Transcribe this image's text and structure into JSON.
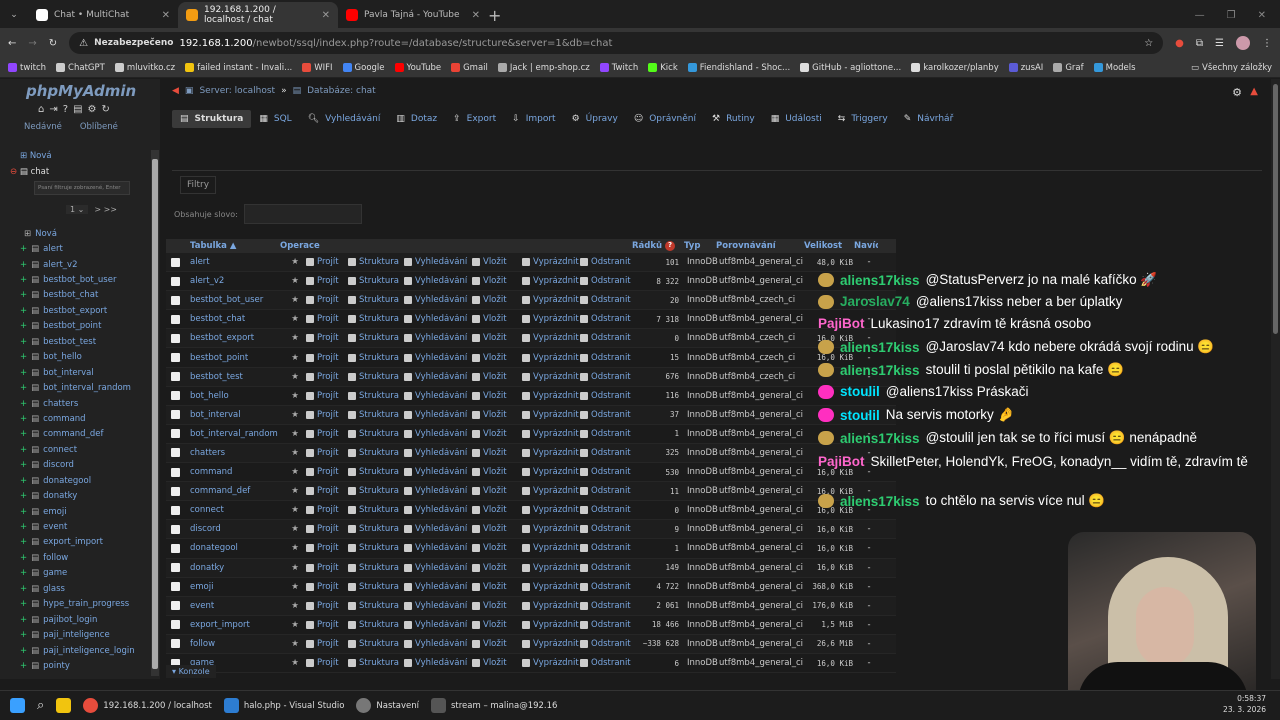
{
  "browser": {
    "tabs": [
      {
        "label": "Chat • MultiChat",
        "color": "#ffffff"
      },
      {
        "label": "192.168.1.200 / localhost / chat",
        "color": "#f39c12"
      },
      {
        "label": "Pavla Tajná - YouTube",
        "color": "#ff0000"
      }
    ],
    "security_badge": "Nezabezpečeno",
    "url_host": "192.168.1.200",
    "url_path": "/newbot/ssql/index.php?route=/database/structure&server=1&db=chat",
    "bookmarks": [
      {
        "label": "twitch",
        "color": "#9146ff"
      },
      {
        "label": "ChatGPT",
        "color": "#cccccc"
      },
      {
        "label": "mluvitko.cz",
        "color": "#cccccc"
      },
      {
        "label": "failed instant - Invali...",
        "color": "#f1c40f"
      },
      {
        "label": "WIFI",
        "color": "#e74c3c"
      },
      {
        "label": "Google",
        "color": "#4285f4"
      },
      {
        "label": "YouTube",
        "color": "#ff0000"
      },
      {
        "label": "Gmail",
        "color": "#ea4335"
      },
      {
        "label": "Jack | emp-shop.cz",
        "color": "#aaaaaa"
      },
      {
        "label": "Twitch",
        "color": "#9146ff"
      },
      {
        "label": "Kick",
        "color": "#53fc18"
      },
      {
        "label": "Fiendishland - Shoc...",
        "color": "#3498db"
      },
      {
        "label": "GitHub - agliottone...",
        "color": "#dddddd"
      },
      {
        "label": "karolkozer/planby",
        "color": "#dddddd"
      },
      {
        "label": "zusAI",
        "color": "#5b5bd6"
      },
      {
        "label": "Graf",
        "color": "#aaaaaa"
      },
      {
        "label": "Models",
        "color": "#3498db"
      }
    ],
    "other_bookmarks": "Všechny záložky"
  },
  "pma": {
    "logo": "phpMyAdmin",
    "sidebar_links": [
      "Nedávné",
      "Oblíbené"
    ],
    "tree_top": [
      "Nová",
      "chat"
    ],
    "filter_placeholder": "Psaní filtruje zobrazené, Enter",
    "pager": "1",
    "pager_next": "> >>",
    "tree_items": [
      "Nová",
      "alert",
      "alert_v2",
      "bestbot_bot_user",
      "bestbot_chat",
      "bestbot_export",
      "bestbot_point",
      "bestbot_test",
      "bot_hello",
      "bot_interval",
      "bot_interval_random",
      "chatters",
      "command",
      "command_def",
      "connect",
      "discord",
      "donategool",
      "donatky",
      "emoji",
      "event",
      "export_import",
      "follow",
      "game",
      "glass",
      "hype_train_progress",
      "pajibot_login",
      "paji_inteligence",
      "paji_inteligence_login",
      "pointy"
    ],
    "breadcrumb": {
      "server": "Server: localhost",
      "db": "Databáze: chat"
    },
    "nav_tabs": [
      "Struktura",
      "SQL",
      "Vyhledávání",
      "Dotaz",
      "Export",
      "Import",
      "Úpravy",
      "Oprávnění",
      "Rutiny",
      "Události",
      "Triggery",
      "Návrhář"
    ],
    "filters_legend": "Filtry",
    "filters_label": "Obsahuje slovo:",
    "table_headers": {
      "name": "Tabulka",
      "ops": "Operace",
      "rows": "Řádků",
      "type": "Typ",
      "collation": "Porovnávání",
      "size": "Velikost",
      "overhead": "Navíc"
    },
    "ops": [
      "Projít",
      "Struktura",
      "Vyhledávání",
      "Vložit",
      "Vyprázdnit",
      "Odstranit"
    ],
    "tables": [
      {
        "name": "alert",
        "rows": "101",
        "type": "InnoDB",
        "coll": "utf8mb4_general_ci",
        "size": "48,0 KiB",
        "ov": "-"
      },
      {
        "name": "alert_v2",
        "rows": "8 322",
        "type": "InnoDB",
        "coll": "utf8mb4_general_ci",
        "size": "",
        "ov": "-"
      },
      {
        "name": "bestbot_bot_user",
        "rows": "20",
        "type": "InnoDB",
        "coll": "utf8mb4_czech_ci",
        "size": "",
        "ov": "-"
      },
      {
        "name": "bestbot_chat",
        "rows": "7 318",
        "type": "InnoDB",
        "coll": "utf8mb4_general_ci",
        "size": "",
        "ov": "-"
      },
      {
        "name": "bestbot_export",
        "rows": "0",
        "type": "InnoDB",
        "coll": "utf8mb4_czech_ci",
        "size": "16,0 KiB",
        "ov": "-"
      },
      {
        "name": "bestbot_point",
        "rows": "15",
        "type": "InnoDB",
        "coll": "utf8mb4_czech_ci",
        "size": "16,0 KiB",
        "ov": "-"
      },
      {
        "name": "bestbot_test",
        "rows": "676",
        "type": "InnoDB",
        "coll": "utf8mb4_czech_ci",
        "size": "",
        "ov": "-"
      },
      {
        "name": "bot_hello",
        "rows": "116",
        "type": "InnoDB",
        "coll": "utf8mb4_general_ci",
        "size": "",
        "ov": "-"
      },
      {
        "name": "bot_interval",
        "rows": "37",
        "type": "InnoDB",
        "coll": "utf8mb4_general_ci",
        "size": "",
        "ov": "-"
      },
      {
        "name": "bot_interval_random",
        "rows": "1",
        "type": "InnoDB",
        "coll": "utf8mb4_general_ci",
        "size": "",
        "ov": "-"
      },
      {
        "name": "chatters",
        "rows": "325",
        "type": "InnoDB",
        "coll": "utf8mb4_general_ci",
        "size": "",
        "ov": "-"
      },
      {
        "name": "command",
        "rows": "530",
        "type": "InnoDB",
        "coll": "utf8mb4_general_ci",
        "size": "16,0 KiB",
        "ov": "-"
      },
      {
        "name": "command_def",
        "rows": "11",
        "type": "InnoDB",
        "coll": "utf8mb4_general_ci",
        "size": "16,0 KiB",
        "ov": "-"
      },
      {
        "name": "connect",
        "rows": "0",
        "type": "InnoDB",
        "coll": "utf8mb4_general_ci",
        "size": "16,0 KiB",
        "ov": "-"
      },
      {
        "name": "discord",
        "rows": "9",
        "type": "InnoDB",
        "coll": "utf8mb4_general_ci",
        "size": "16,0 KiB",
        "ov": "-"
      },
      {
        "name": "donategool",
        "rows": "1",
        "type": "InnoDB",
        "coll": "utf8mb4_general_ci",
        "size": "16,0 KiB",
        "ov": "-"
      },
      {
        "name": "donatky",
        "rows": "149",
        "type": "InnoDB",
        "coll": "utf8mb4_general_ci",
        "size": "16,0 KiB",
        "ov": "-"
      },
      {
        "name": "emoji",
        "rows": "4 722",
        "type": "InnoDB",
        "coll": "utf8mb4_general_ci",
        "size": "368,0 KiB",
        "ov": "-"
      },
      {
        "name": "event",
        "rows": "2 061",
        "type": "InnoDB",
        "coll": "utf8mb4_general_ci",
        "size": "176,0 KiB",
        "ov": "-"
      },
      {
        "name": "export_import",
        "rows": "18 466",
        "type": "InnoDB",
        "coll": "utf8mb4_general_ci",
        "size": "1,5 MiB",
        "ov": "-"
      },
      {
        "name": "follow",
        "rows": "~338 628",
        "type": "InnoDB",
        "coll": "utf8mb4_general_ci",
        "size": "26,6 MiB",
        "ov": "-"
      },
      {
        "name": "game",
        "rows": "6",
        "type": "InnoDB",
        "coll": "utf8mb4_general_ci",
        "size": "16,0 KiB",
        "ov": "-"
      }
    ],
    "console": "Konzole"
  },
  "chat": [
    {
      "user": "aliens17kiss",
      "color": "#2ecc71",
      "text": "@StatusPerverz jo na malé kafíčko 🚀"
    },
    {
      "user": "Jaroslav74",
      "color": "#27ae60",
      "text": "@aliens17kiss neber a ber úplatky"
    },
    {
      "user": "PajiBot",
      "color": "#ff66cc",
      "text": "Lukasino17 zdravím tě krásná osobo"
    },
    {
      "user": "aliens17kiss",
      "color": "#2ecc71",
      "text": "@Jaroslav74 kdo nebere okrádá svojí rodinu 😑"
    },
    {
      "user": "aliens17kiss",
      "color": "#2ecc71",
      "text": "stoulil ti poslal pětikilo na kafe 😑"
    },
    {
      "user": "stoulil",
      "color": "#00e5ff",
      "text": "@aliens17kiss Práskači"
    },
    {
      "user": "stoulil",
      "color": "#00e5ff",
      "text": "Na servis motorky 🤌"
    },
    {
      "user": "aliens17kiss",
      "color": "#2ecc71",
      "text": "@stoulil jen tak se to říci musí 😑 nenápadně"
    },
    {
      "user": "PajiBot",
      "color": "#ff66cc",
      "text": "SkilletPeter, HolendYk, FreOG, konadyn__ vidím tě, zdravím tě"
    },
    {
      "user": "aliens17kiss",
      "color": "#2ecc71",
      "text": "to chtělo na servis více nul 😑"
    }
  ],
  "taskbar": {
    "items": [
      "192.168.1.200 / localhost",
      "halo.php - Visual Studio",
      "Nastavení",
      "stream – malina@192.16"
    ],
    "time": "0:58:37",
    "date": "23. 3. 2026"
  }
}
